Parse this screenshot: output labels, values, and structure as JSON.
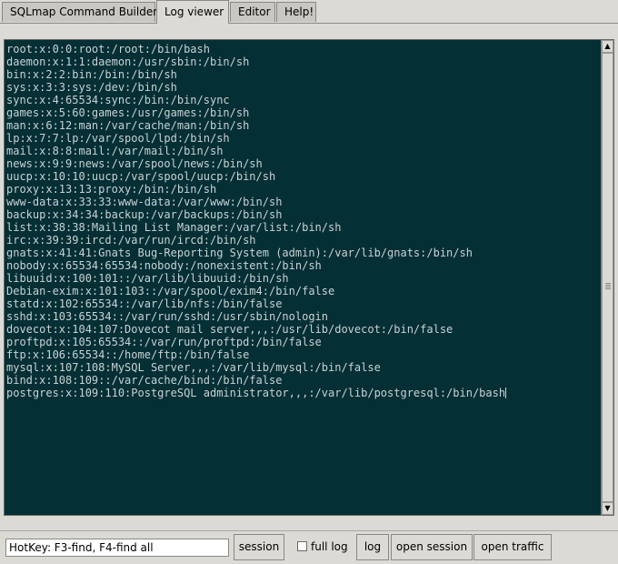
{
  "tabs": [
    {
      "label": "SQLmap Command Builder",
      "active": false
    },
    {
      "label": "Log viewer",
      "active": true
    },
    {
      "label": "Editor",
      "active": false
    },
    {
      "label": "Help!",
      "active": false
    }
  ],
  "log": {
    "lines": [
      "root:x:0:0:root:/root:/bin/bash",
      "daemon:x:1:1:daemon:/usr/sbin:/bin/sh",
      "bin:x:2:2:bin:/bin:/bin/sh",
      "sys:x:3:3:sys:/dev:/bin/sh",
      "sync:x:4:65534:sync:/bin:/bin/sync",
      "games:x:5:60:games:/usr/games:/bin/sh",
      "man:x:6:12:man:/var/cache/man:/bin/sh",
      "lp:x:7:7:lp:/var/spool/lpd:/bin/sh",
      "mail:x:8:8:mail:/var/mail:/bin/sh",
      "news:x:9:9:news:/var/spool/news:/bin/sh",
      "uucp:x:10:10:uucp:/var/spool/uucp:/bin/sh",
      "proxy:x:13:13:proxy:/bin:/bin/sh",
      "www-data:x:33:33:www-data:/var/www:/bin/sh",
      "backup:x:34:34:backup:/var/backups:/bin/sh",
      "list:x:38:38:Mailing List Manager:/var/list:/bin/sh",
      "irc:x:39:39:ircd:/var/run/ircd:/bin/sh",
      "gnats:x:41:41:Gnats Bug-Reporting System (admin):/var/lib/gnats:/bin/sh",
      "nobody:x:65534:65534:nobody:/nonexistent:/bin/sh",
      "libuuid:x:100:101::/var/lib/libuuid:/bin/sh",
      "Debian-exim:x:101:103::/var/spool/exim4:/bin/false",
      "statd:x:102:65534::/var/lib/nfs:/bin/false",
      "sshd:x:103:65534::/var/run/sshd:/usr/sbin/nologin",
      "dovecot:x:104:107:Dovecot mail server,,,:/usr/lib/dovecot:/bin/false",
      "proftpd:x:105:65534::/var/run/proftpd:/bin/false",
      "ftp:x:106:65534::/home/ftp:/bin/false",
      "mysql:x:107:108:MySQL Server,,,:/var/lib/mysql:/bin/false",
      "bind:x:108:109::/var/cache/bind:/bin/false",
      "postgres:x:109:110:PostgreSQL administrator,,,:/var/lib/postgresql:/bin/bash"
    ],
    "background": "#042f35",
    "text_color": "#c8d2d4"
  },
  "scrollbar": {
    "up_icon": "arrow-up-icon",
    "down_icon": "arrow-down-icon"
  },
  "bottom": {
    "hotkey_value": "HotKey: F3-find, F4-find all",
    "session_label": "session",
    "full_log_label": "full log",
    "full_log_checked": false,
    "log_label": "log",
    "open_session_label": "open session",
    "open_traffic_label": "open traffic"
  }
}
